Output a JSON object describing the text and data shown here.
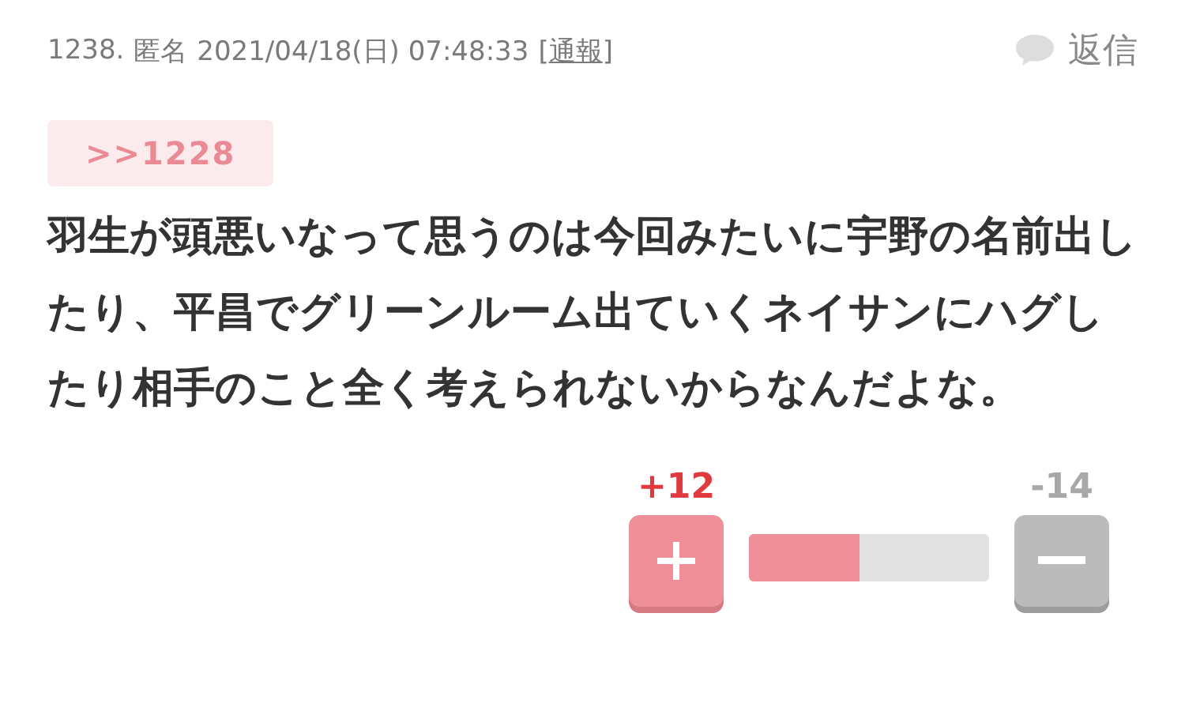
{
  "comment": {
    "number": "1238.",
    "author": "匿名",
    "date": "2021/04/18(日) 07:48:33",
    "report": {
      "open": "[",
      "label": "通報",
      "close": "]"
    },
    "reply": "返信",
    "anchor": ">>1228",
    "body": "羽生が頭悪いなって思うのは今回みたいに宇野の名前出したり、平昌でグリーンルーム出ていくネイサンにハグしたり相手のこと全く考えられないからなんだよな。"
  },
  "votes": {
    "plus": "+12",
    "minus": "-14",
    "level": 0.46
  }
}
